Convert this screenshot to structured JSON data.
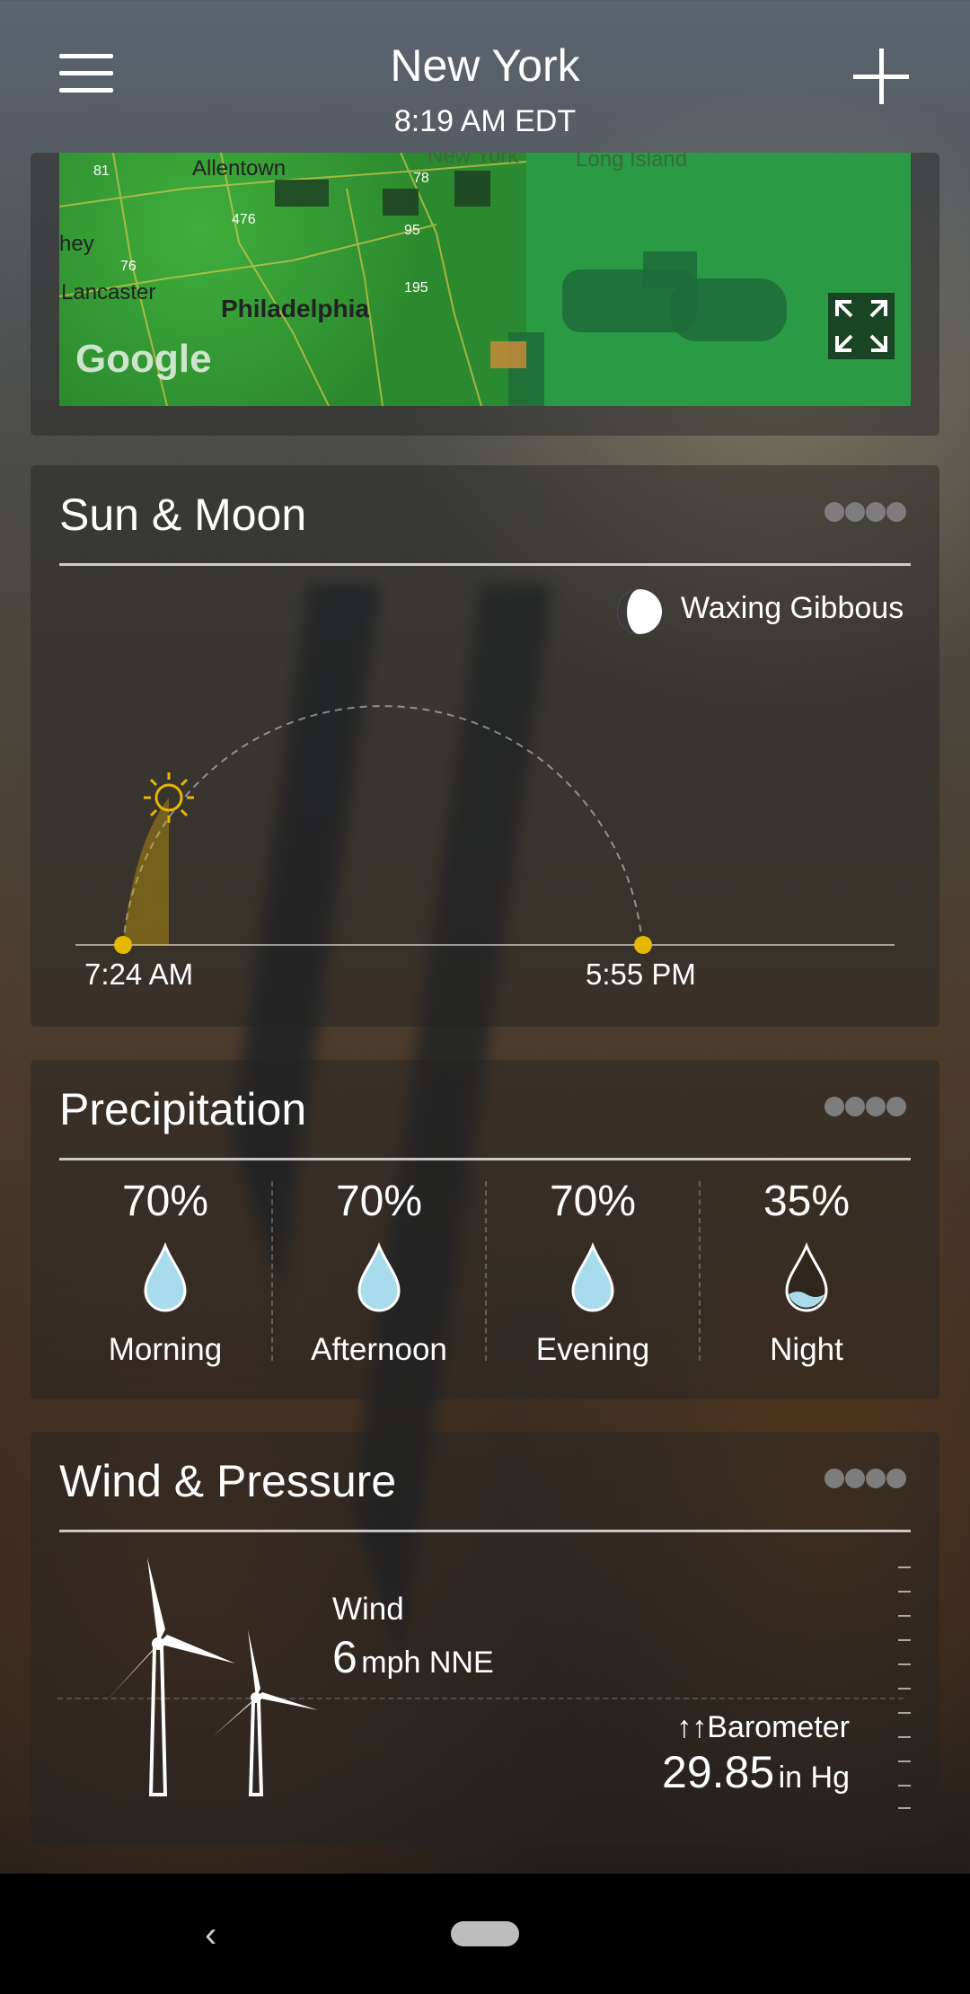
{
  "header": {
    "city": "New York",
    "time": "8:19 AM EDT"
  },
  "map": {
    "provider": "Google",
    "labels": {
      "allentown": "Allentown",
      "philadelphia": "Philadelphia",
      "lancaster": "Lancaster",
      "hey": "hey",
      "long_island": "Long Island",
      "new_york": "New York"
    },
    "route_shields": [
      "81",
      "476",
      "78",
      "95",
      "76",
      "195"
    ]
  },
  "sun_moon": {
    "title": "Sun & Moon",
    "moon_phase": "Waxing Gibbous",
    "sunrise": "7:24 AM",
    "sunset": "5:55 PM"
  },
  "precipitation": {
    "title": "Precipitation",
    "periods": [
      {
        "label": "Morning",
        "percent": "70%"
      },
      {
        "label": "Afternoon",
        "percent": "70%"
      },
      {
        "label": "Evening",
        "percent": "70%"
      },
      {
        "label": "Night",
        "percent": "35%"
      }
    ]
  },
  "wind_pressure": {
    "title": "Wind & Pressure",
    "wind_label": "Wind",
    "wind_speed": "6",
    "wind_unit": "mph NNE",
    "barometer_label": "↑↑Barometer",
    "barometer_value": "29.85",
    "barometer_unit": "in Hg"
  },
  "colors": {
    "sun": "#e6b800",
    "drop_fill": "#a8dcec",
    "map_green": "#2e9a3a"
  },
  "icons": {
    "menu": "hamburger-menu-icon",
    "add": "plus-icon",
    "expand": "expand-icon",
    "more": "more-dots-icon",
    "moon": "moon-phase-icon",
    "sun": "sun-icon",
    "drop": "raindrop-icon",
    "turbine": "wind-turbine-icon",
    "back": "back-chevron-icon"
  }
}
